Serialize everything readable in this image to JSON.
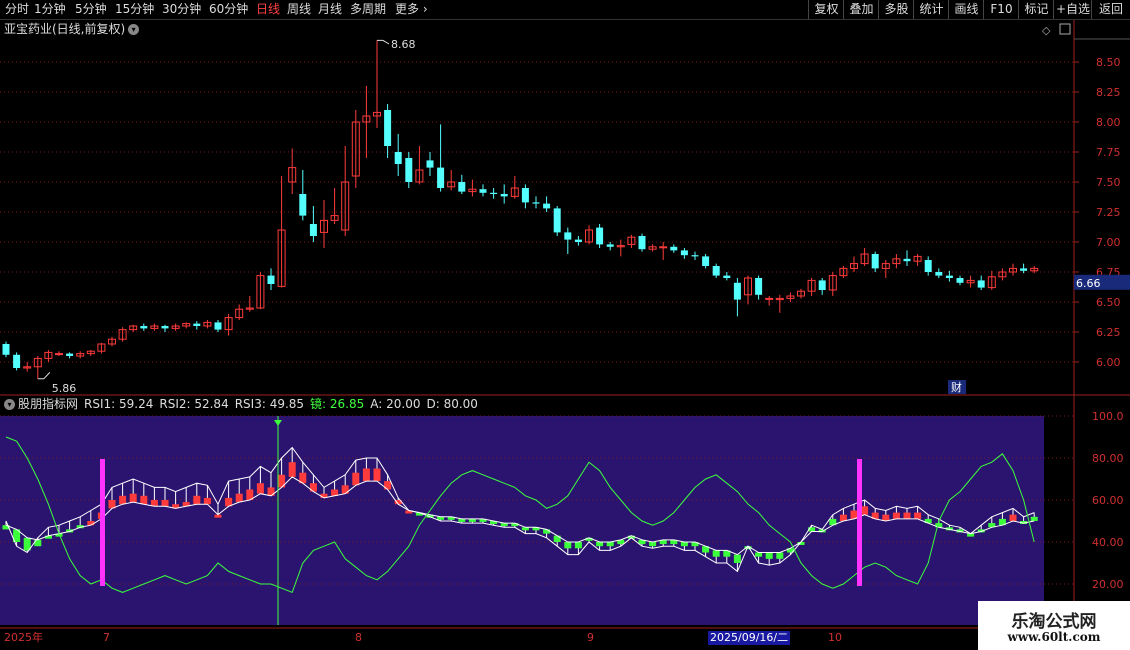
{
  "toolbar": {
    "periods": [
      "分时",
      "1分钟",
      "5分钟",
      "15分钟",
      "30分钟",
      "60分钟",
      "日线",
      "周线",
      "月线",
      "多周期",
      "更多"
    ],
    "more_arrow": "›",
    "active_period": "日线",
    "right_buttons": [
      "复权",
      "叠加",
      "多股",
      "统计",
      "画线",
      "F10",
      "标记",
      "+自选",
      "返回"
    ]
  },
  "chart_header": {
    "stock_title": "亚宝药业(日线,前复权)",
    "high_label": "8.68",
    "low_label": "5.86",
    "current_price": "6.66",
    "fin_badge": "财"
  },
  "price_axis": {
    "ticks": [
      "8.50",
      "8.25",
      "8.00",
      "7.75",
      "7.50",
      "7.25",
      "7.00",
      "6.75",
      "6.50",
      "6.25",
      "6.00"
    ]
  },
  "indicator": {
    "name": "股朋指标网",
    "values": [
      {
        "label": "RSI1: 59.24",
        "color": "#dddddd"
      },
      {
        "label": "RSI2: 52.84",
        "color": "#dddddd"
      },
      {
        "label": "RSI3: 49.85",
        "color": "#dddddd"
      },
      {
        "label": "镜: 26.85",
        "color": "#40ff40"
      },
      {
        "label": "A: 20.00",
        "color": "#dddddd"
      },
      {
        "label": "D: 80.00",
        "color": "#dddddd"
      }
    ],
    "axis_ticks": [
      "100.0",
      "80.00",
      "60.00",
      "40.00",
      "20.00"
    ]
  },
  "time_axis": {
    "labels": [
      "2025年",
      "7",
      "8",
      "9",
      "10"
    ],
    "cursor_date": "2025/09/16/二"
  },
  "watermark": {
    "line1": "乐淘公式网",
    "line2": "www.60lt.com"
  },
  "colors": {
    "up": "#ff3b3b",
    "down": "#54ffff",
    "ind_bg": "#2a1470",
    "green": "#3cff3c",
    "magenta": "#ff33ff"
  },
  "chart_data": {
    "type": "candlestick",
    "title": "亚宝药业(日线,前复权)",
    "high": 8.68,
    "low": 5.86,
    "last": 6.66,
    "ylim": [
      5.85,
      8.7
    ],
    "candles": [
      [
        6.15,
        6.06,
        6.17,
        6.04
      ],
      [
        6.06,
        5.95,
        6.08,
        5.93
      ],
      [
        5.95,
        5.96,
        6.0,
        5.92
      ],
      [
        5.96,
        6.03,
        6.05,
        5.86
      ],
      [
        6.03,
        6.08,
        6.1,
        6.0
      ],
      [
        6.07,
        6.07,
        6.09,
        6.05
      ],
      [
        6.07,
        6.05,
        6.08,
        6.03
      ],
      [
        6.05,
        6.07,
        6.09,
        6.03
      ],
      [
        6.07,
        6.09,
        6.1,
        6.05
      ],
      [
        6.09,
        6.15,
        6.16,
        6.07
      ],
      [
        6.15,
        6.19,
        6.21,
        6.13
      ],
      [
        6.19,
        6.27,
        6.29,
        6.17
      ],
      [
        6.27,
        6.3,
        6.31,
        6.25
      ],
      [
        6.3,
        6.28,
        6.32,
        6.26
      ],
      [
        6.28,
        6.3,
        6.32,
        6.26
      ],
      [
        6.3,
        6.28,
        6.31,
        6.25
      ],
      [
        6.28,
        6.3,
        6.32,
        6.26
      ],
      [
        6.3,
        6.32,
        6.33,
        6.28
      ],
      [
        6.32,
        6.3,
        6.34,
        6.27
      ],
      [
        6.3,
        6.33,
        6.35,
        6.28
      ],
      [
        6.33,
        6.27,
        6.35,
        6.25
      ],
      [
        6.27,
        6.37,
        6.4,
        6.22
      ],
      [
        6.37,
        6.44,
        6.48,
        6.35
      ],
      [
        6.44,
        6.45,
        6.55,
        6.42
      ],
      [
        6.45,
        6.72,
        6.75,
        6.44
      ],
      [
        6.72,
        6.65,
        6.78,
        6.6
      ],
      [
        6.63,
        7.1,
        7.55,
        6.62
      ],
      [
        7.5,
        7.62,
        7.78,
        7.4
      ],
      [
        7.4,
        7.22,
        7.6,
        7.18
      ],
      [
        7.15,
        7.05,
        7.3,
        7.0
      ],
      [
        7.08,
        7.18,
        7.35,
        6.95
      ],
      [
        7.18,
        7.22,
        7.45,
        7.15
      ],
      [
        7.1,
        7.5,
        7.8,
        7.05
      ],
      [
        7.55,
        8.0,
        8.1,
        7.45
      ],
      [
        8.0,
        8.05,
        8.3,
        7.7
      ],
      [
        8.05,
        8.08,
        8.68,
        7.95
      ],
      [
        8.1,
        7.8,
        8.15,
        7.7
      ],
      [
        7.75,
        7.65,
        7.9,
        7.55
      ],
      [
        7.7,
        7.5,
        7.75,
        7.45
      ],
      [
        7.5,
        7.6,
        7.8,
        7.48
      ],
      [
        7.68,
        7.62,
        7.75,
        7.55
      ],
      [
        7.62,
        7.45,
        7.98,
        7.42
      ],
      [
        7.46,
        7.5,
        7.6,
        7.43
      ],
      [
        7.5,
        7.42,
        7.56,
        7.4
      ],
      [
        7.42,
        7.44,
        7.52,
        7.38
      ],
      [
        7.44,
        7.41,
        7.48,
        7.38
      ],
      [
        7.41,
        7.4,
        7.45,
        7.36
      ],
      [
        7.4,
        7.38,
        7.48,
        7.32
      ],
      [
        7.38,
        7.45,
        7.55,
        7.36
      ],
      [
        7.45,
        7.33,
        7.48,
        7.28
      ],
      [
        7.33,
        7.32,
        7.38,
        7.28
      ],
      [
        7.32,
        7.28,
        7.38,
        7.25
      ],
      [
        7.28,
        7.08,
        7.3,
        7.05
      ],
      [
        7.08,
        7.02,
        7.12,
        6.9
      ],
      [
        7.02,
        7.0,
        7.05,
        6.97
      ],
      [
        7.0,
        7.1,
        7.14,
        6.98
      ],
      [
        7.12,
        6.98,
        7.15,
        6.95
      ],
      [
        6.98,
        6.96,
        7.0,
        6.93
      ],
      [
        6.96,
        6.97,
        7.02,
        6.88
      ],
      [
        6.98,
        7.04,
        7.06,
        6.95
      ],
      [
        7.05,
        6.94,
        7.07,
        6.92
      ],
      [
        6.94,
        6.96,
        6.98,
        6.92
      ],
      [
        6.96,
        6.96,
        7.0,
        6.85
      ],
      [
        6.96,
        6.93,
        6.98,
        6.91
      ],
      [
        6.93,
        6.89,
        6.95,
        6.86
      ],
      [
        6.89,
        6.88,
        6.92,
        6.85
      ],
      [
        6.88,
        6.8,
        6.9,
        6.78
      ],
      [
        6.8,
        6.72,
        6.82,
        6.7
      ],
      [
        6.72,
        6.7,
        6.75,
        6.68
      ],
      [
        6.66,
        6.52,
        6.7,
        6.38
      ],
      [
        6.56,
        6.7,
        6.72,
        6.48
      ],
      [
        6.7,
        6.56,
        6.72,
        6.52
      ],
      [
        6.53,
        6.53,
        6.55,
        6.47
      ],
      [
        6.52,
        6.53,
        6.56,
        6.41
      ],
      [
        6.53,
        6.55,
        6.58,
        6.5
      ],
      [
        6.55,
        6.59,
        6.61,
        6.53
      ],
      [
        6.59,
        6.68,
        6.7,
        6.55
      ],
      [
        6.68,
        6.6,
        6.7,
        6.56
      ],
      [
        6.6,
        6.72,
        6.75,
        6.55
      ],
      [
        6.72,
        6.78,
        6.8,
        6.7
      ],
      [
        6.78,
        6.82,
        6.88,
        6.75
      ],
      [
        6.82,
        6.9,
        6.95,
        6.8
      ],
      [
        6.9,
        6.78,
        6.92,
        6.75
      ],
      [
        6.78,
        6.82,
        6.85,
        6.7
      ],
      [
        6.82,
        6.86,
        6.9,
        6.78
      ],
      [
        6.86,
        6.84,
        6.93,
        6.8
      ],
      [
        6.84,
        6.88,
        6.9,
        6.8
      ],
      [
        6.85,
        6.75,
        6.88,
        6.72
      ],
      [
        6.75,
        6.72,
        6.78,
        6.7
      ],
      [
        6.72,
        6.7,
        6.76,
        6.67
      ],
      [
        6.7,
        6.66,
        6.72,
        6.64
      ],
      [
        6.66,
        6.68,
        6.72,
        6.62
      ],
      [
        6.68,
        6.62,
        6.72,
        6.6
      ],
      [
        6.62,
        6.71,
        6.76,
        6.6
      ],
      [
        6.71,
        6.75,
        6.78,
        6.68
      ],
      [
        6.75,
        6.78,
        6.82,
        6.72
      ],
      [
        6.78,
        6.76,
        6.82,
        6.74
      ],
      [
        6.76,
        6.78,
        6.8,
        6.74
      ]
    ],
    "rsi_axis": [
      0,
      100
    ],
    "rsi1": [
      50,
      38,
      35,
      42,
      47,
      48,
      50,
      52,
      55,
      58,
      66,
      68,
      70,
      68,
      66,
      66,
      64,
      66,
      68,
      67,
      58,
      69,
      70,
      71,
      76,
      73,
      80,
      85,
      78,
      72,
      66,
      69,
      72,
      79,
      80,
      80,
      72,
      61,
      55,
      54,
      52,
      50,
      50,
      49,
      49,
      49,
      48,
      47,
      47,
      44,
      44,
      42,
      38,
      34,
      34,
      40,
      36,
      36,
      38,
      42,
      38,
      37,
      38,
      38,
      36,
      36,
      33,
      30,
      30,
      26,
      38,
      30,
      29,
      30,
      34,
      40,
      48,
      46,
      53,
      56,
      58,
      60,
      56,
      55,
      57,
      56,
      57,
      53,
      51,
      48,
      47,
      44,
      48,
      52,
      54,
      56,
      52,
      54
    ],
    "rsi2": [
      46,
      40,
      36,
      38,
      42,
      44,
      46,
      48,
      50,
      54,
      60,
      62,
      63,
      62,
      60,
      60,
      58,
      59,
      62,
      61,
      53,
      61,
      63,
      65,
      68,
      66,
      72,
      78,
      73,
      68,
      63,
      65,
      67,
      73,
      75,
      75,
      69,
      60,
      55,
      54,
      52,
      51,
      51,
      50,
      50,
      50,
      49,
      48,
      48,
      46,
      46,
      44,
      40,
      37,
      37,
      41,
      38,
      38,
      39,
      42,
      39,
      38,
      39,
      39,
      38,
      38,
      35,
      33,
      33,
      30,
      38,
      33,
      32,
      32,
      35,
      40,
      47,
      46,
      51,
      53,
      55,
      57,
      54,
      53,
      54,
      54,
      54,
      51,
      49,
      47,
      46,
      44,
      46,
      49,
      51,
      53,
      50,
      52
    ],
    "rsi3": [
      48,
      46,
      42,
      41,
      43,
      44,
      45,
      47,
      48,
      51,
      56,
      58,
      59,
      58,
      57,
      57,
      56,
      57,
      58,
      58,
      53,
      57,
      59,
      60,
      63,
      62,
      66,
      71,
      68,
      64,
      61,
      62,
      63,
      67,
      69,
      69,
      65,
      58,
      55,
      54,
      53,
      52,
      52,
      51,
      51,
      51,
      50,
      49,
      49,
      47,
      47,
      46,
      43,
      40,
      40,
      42,
      40,
      40,
      41,
      43,
      41,
      40,
      41,
      41,
      40,
      40,
      38,
      36,
      36,
      34,
      38,
      35,
      35,
      35,
      37,
      40,
      45,
      45,
      48,
      50,
      51,
      53,
      51,
      50,
      51,
      51,
      51,
      49,
      47,
      46,
      45,
      44,
      45,
      47,
      48,
      50,
      49,
      50
    ],
    "jing": [
      90,
      88,
      80,
      70,
      58,
      44,
      32,
      24,
      20,
      22,
      18,
      16,
      18,
      20,
      22,
      24,
      22,
      20,
      22,
      24,
      30,
      26,
      24,
      22,
      20,
      20,
      18,
      16,
      30,
      36,
      38,
      40,
      32,
      28,
      24,
      22,
      26,
      32,
      38,
      48,
      55,
      62,
      68,
      72,
      74,
      72,
      70,
      68,
      66,
      62,
      60,
      56,
      58,
      62,
      70,
      78,
      74,
      66,
      60,
      54,
      50,
      48,
      50,
      54,
      60,
      66,
      70,
      72,
      68,
      64,
      58,
      54,
      48,
      44,
      40,
      30,
      24,
      20,
      18,
      20,
      24,
      28,
      30,
      28,
      24,
      22,
      20,
      30,
      50,
      60,
      64,
      70,
      76,
      78,
      82,
      74,
      60,
      40
    ]
  }
}
